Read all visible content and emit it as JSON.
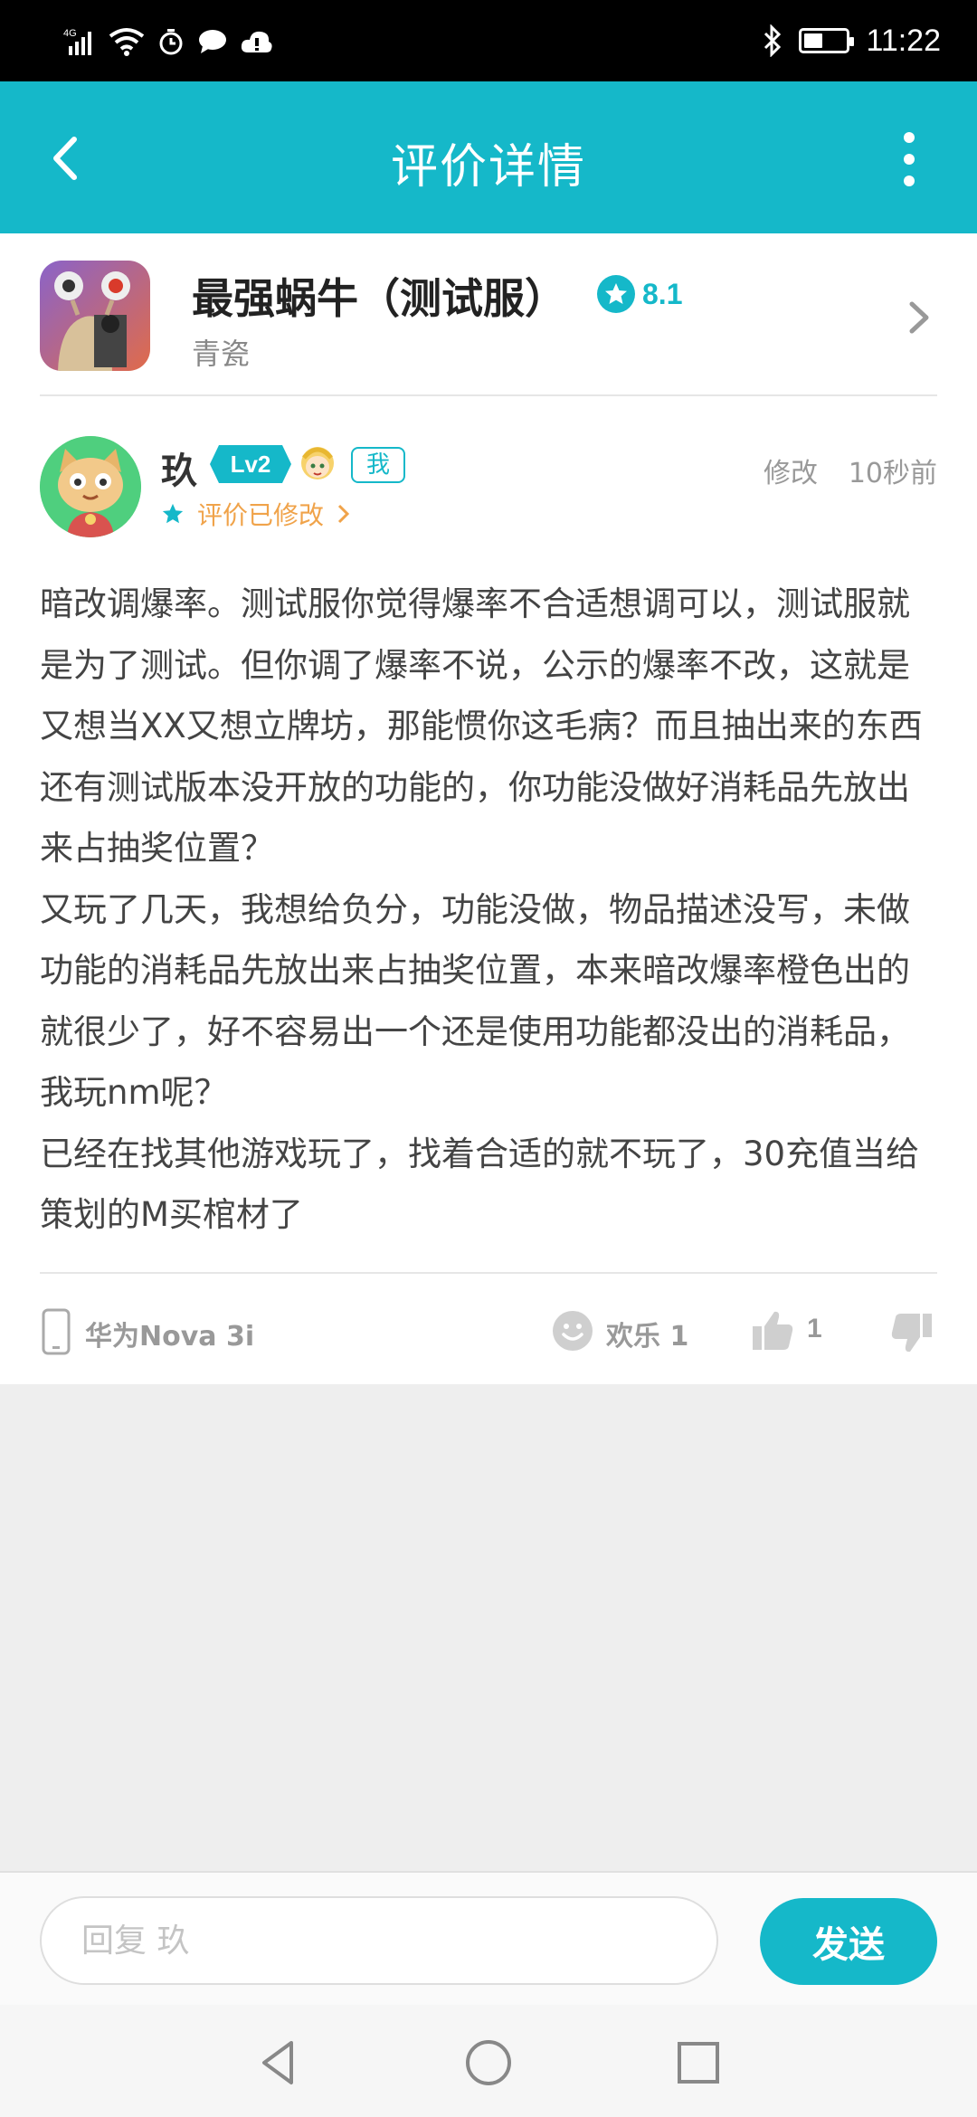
{
  "status_bar": {
    "network": "4G",
    "time": "11:22",
    "battery_level": 0.45,
    "icons": [
      "signal-icon",
      "wifi-icon",
      "alarm-icon",
      "chat-icon",
      "cloud-icon",
      "bluetooth-icon",
      "battery-icon"
    ]
  },
  "app_bar": {
    "title": "评价详情",
    "back_icon": "chevron-left-icon",
    "more_icon": "more-vertical-icon"
  },
  "game": {
    "name": "最强蜗牛（测试服）",
    "rating": "8.1",
    "developer": "青瓷"
  },
  "review": {
    "user_name": "玖",
    "level": "Lv2",
    "me_badge": "我",
    "edited_label": "评价已修改",
    "edit_label": "修改",
    "time": "10秒前",
    "star_rating": 1,
    "body": "暗改调爆率。测试服你觉得爆率不合适想调可以，测试服就是为了测试。但你调了爆率不说，公示的爆率不改，这就是又想当XX又想立牌坊，那能惯你这毛病？而且抽出来的东西还有测试版本没开放的功能的，你功能没做好消耗品先放出来占抽奖位置？\n又玩了几天，我想给负分，功能没做，物品描述没写，未做功能的消耗品先放出来占抽奖位置，本来暗改爆率橙色出的就很少了，好不容易出一个还是使用功能都没出的消耗品，我玩nm呢？\n已经在找其他游戏玩了，找着合适的就不玩了，30充值当给策划的M买棺材了"
  },
  "actions": {
    "device": "华为Nova 3i",
    "fun_label": "欢乐 1",
    "like_count": "1"
  },
  "reply": {
    "placeholder": "回复 玖",
    "value": "",
    "send_label": "发送"
  },
  "colors": {
    "accent": "#15b8c9",
    "edited": "#f0a34a",
    "text_primary": "#333333",
    "text_secondary": "#999999"
  }
}
